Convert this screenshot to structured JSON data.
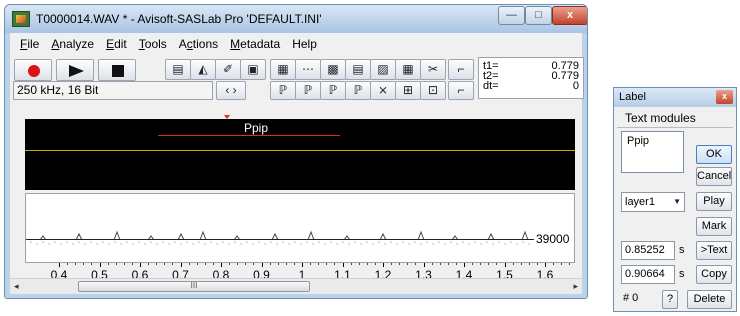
{
  "window": {
    "title": "T0000014.WAV * - Avisoft-SASLab Pro  'DEFAULT.INI'",
    "btn_minimize": "—",
    "btn_maximize": "□",
    "btn_close": "x"
  },
  "menu": [
    {
      "u": "F",
      "rest": "ile"
    },
    {
      "u": "A",
      "rest": "nalyze"
    },
    {
      "u": "E",
      "rest": "dit"
    },
    {
      "u": "T",
      "rest": "ools"
    },
    {
      "pre": "A",
      "u": "c",
      "rest": "tions"
    },
    {
      "u": "M",
      "rest": "etadata"
    },
    {
      "pre": "Help",
      "u": "",
      "rest": ""
    }
  ],
  "toolbar": {
    "format_info": "250 kHz, 16 Bit",
    "t1_label": "t1=",
    "t1_value": "0.779",
    "t2_label": "t2=",
    "t2_value": "0.779",
    "dt_label": "dt=",
    "dt_value": "0",
    "nav_glyph": "‹ ›",
    "icons": {
      "r1": [
        "▤",
        "◭",
        "✐",
        "▣",
        "▦",
        "⋯",
        "▩",
        "▤",
        "▨",
        "▦",
        "✂",
        "⌐"
      ],
      "r2": [
        "ℙ",
        "ℙ",
        "ℙ",
        "ℙ",
        "⨯",
        "⊞",
        "⊡",
        "⌐"
      ]
    }
  },
  "label_strip": {
    "label": "Ppip"
  },
  "envelope": {
    "value_label": "39000"
  },
  "axis": {
    "ticks": [
      "0.4",
      "0.5",
      "0.6",
      "0.7",
      "0.8",
      "0.9",
      "1",
      "1.1",
      "1.2",
      "1.3",
      "1.4",
      "1.5",
      "1.6"
    ]
  },
  "scrollbar": {
    "left_arrow": "◂",
    "right_arrow": "▸",
    "grip": "III"
  },
  "dialog": {
    "title": "Label",
    "close": "x",
    "header": "Text modules",
    "text_value": "Ppip",
    "ok": "OK",
    "cancel": "Cancel",
    "layer_select": "layer1",
    "play": "Play",
    "mark": "Mark",
    "start_value": "0.85252",
    "end_value": "0.90664",
    "unit": "s",
    "to_text": ">Text",
    "copy": "Copy",
    "count": "# 0",
    "help": "?",
    "delete": "Delete"
  }
}
